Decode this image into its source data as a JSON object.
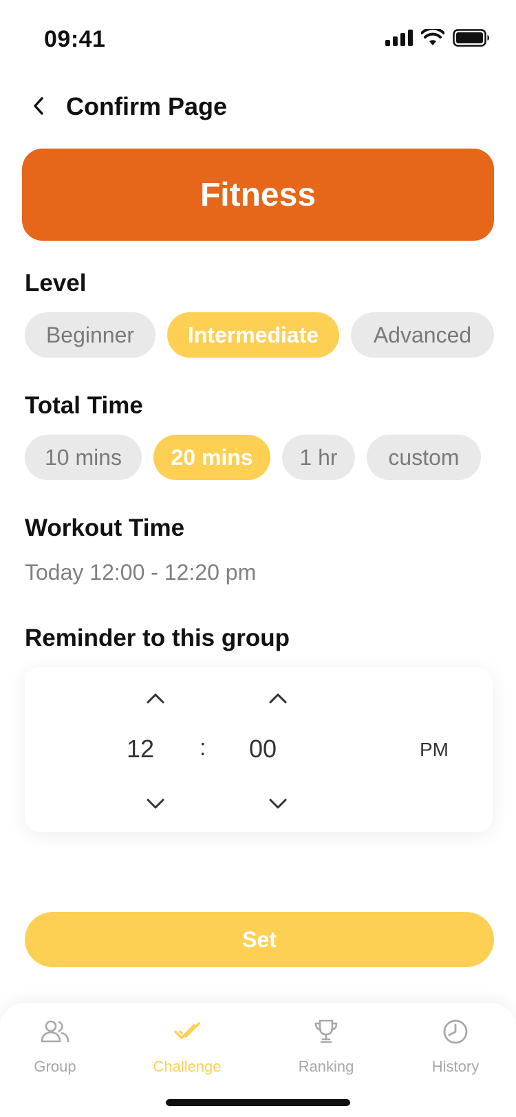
{
  "status_bar": {
    "time": "09:41"
  },
  "header": {
    "title": "Confirm Page"
  },
  "banner": {
    "title": "Fitness",
    "color": "#e6661a"
  },
  "level": {
    "label": "Level",
    "options": [
      "Beginner",
      "Intermediate",
      "Advanced"
    ],
    "selected": "Intermediate"
  },
  "total_time": {
    "label": "Total Time",
    "options": [
      "10 mins",
      "20 mins",
      "1 hr",
      "custom"
    ],
    "selected": "20 mins"
  },
  "workout_time": {
    "label": "Workout Time",
    "value": "Today 12:00 - 12:20 pm"
  },
  "reminder": {
    "label": "Reminder to this group",
    "hour": "12",
    "separator": ":",
    "minute": "00",
    "period": "PM"
  },
  "set_button": {
    "label": "Set"
  },
  "tabs": [
    {
      "label": "Group",
      "icon": "users-icon"
    },
    {
      "label": "Challenge",
      "icon": "double-check-icon",
      "active": true
    },
    {
      "label": "Ranking",
      "icon": "trophy-icon"
    },
    {
      "label": "History",
      "icon": "history-clock-icon"
    }
  ],
  "colors": {
    "accent": "#fdd054",
    "brand": "#e6661a",
    "chip_bg": "#e9e9e9",
    "muted_text": "#808080"
  }
}
